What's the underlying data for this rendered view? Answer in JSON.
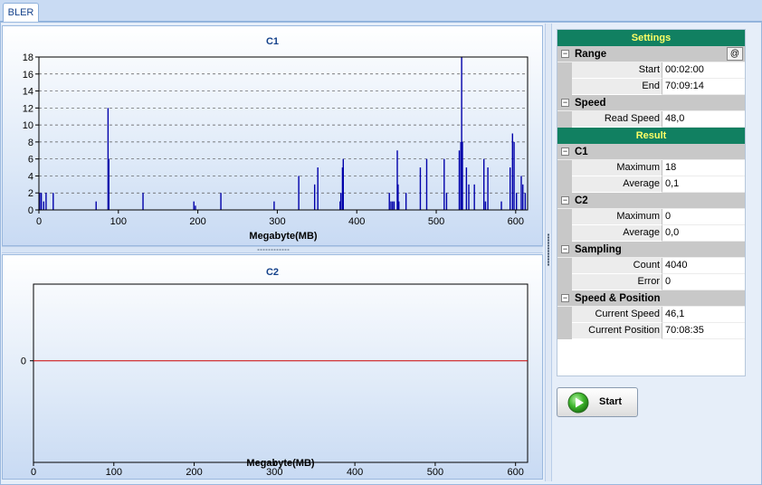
{
  "tabs": [
    {
      "label": "BLER"
    }
  ],
  "charts": {
    "c1": {
      "title": "C1",
      "xlabel": "Megabyte(MB)",
      "x_ticks": [
        "0",
        "100",
        "200",
        "300",
        "400",
        "500",
        "600"
      ],
      "y_ticks": [
        "0",
        "2",
        "4",
        "6",
        "8",
        "10",
        "12",
        "14",
        "16",
        "18"
      ]
    },
    "c2": {
      "title": "C2",
      "xlabel": "Megabyte(MB)",
      "x_ticks": [
        "0",
        "100",
        "200",
        "300",
        "400",
        "500",
        "600"
      ],
      "y_ticks": [
        "0"
      ]
    }
  },
  "chart_data": [
    {
      "type": "bar",
      "title": "C1",
      "xlabel": "Megabyte(MB)",
      "ylabel": "",
      "xlim": [
        0,
        615
      ],
      "ylim": [
        0,
        18
      ],
      "grid": true,
      "color": "#0000aa",
      "x": [
        1,
        3,
        6,
        9,
        18,
        72,
        87,
        88,
        131,
        195,
        197,
        229,
        296,
        327,
        347,
        351,
        379,
        380,
        382,
        383,
        441,
        443,
        445,
        447,
        451,
        452,
        453,
        462,
        480,
        488,
        510,
        513,
        529,
        531,
        532,
        533,
        538,
        541,
        548,
        560,
        562,
        565,
        582,
        593,
        596,
        598,
        601,
        607,
        609,
        612
      ],
      "values": [
        2,
        2,
        1,
        2,
        2,
        1,
        12,
        6,
        2,
        1,
        0.5,
        2,
        1,
        4,
        3,
        5,
        1,
        2,
        5,
        6,
        2,
        1,
        1,
        1,
        7,
        3,
        1,
        2,
        5,
        6,
        6,
        2,
        7,
        8,
        18,
        8,
        5,
        3,
        3,
        6,
        1,
        5,
        1,
        5,
        9,
        8,
        2,
        4,
        3,
        2
      ]
    },
    {
      "type": "line",
      "title": "C2",
      "xlabel": "Megabyte(MB)",
      "ylabel": "",
      "xlim": [
        0,
        615
      ],
      "color": "#cc0000",
      "x": [
        0,
        615
      ],
      "values": [
        0,
        0
      ]
    }
  ],
  "settings_header": "Settings",
  "result_header": "Result",
  "sections": {
    "range": {
      "label": "Range",
      "btn": "@",
      "toggle": "−",
      "start_label": "Start",
      "start_value": "00:02:00",
      "end_label": "End",
      "end_value": "70:09:14"
    },
    "speed": {
      "label": "Speed",
      "toggle": "−",
      "read_label": "Read Speed",
      "read_value": "48,0"
    },
    "c1": {
      "label": "C1",
      "toggle": "−",
      "max_label": "Maximum",
      "max_value": "18",
      "avg_label": "Average",
      "avg_value": "0,1"
    },
    "c2": {
      "label": "C2",
      "toggle": "−",
      "max_label": "Maximum",
      "max_value": "0",
      "avg_label": "Average",
      "avg_value": "0,0"
    },
    "sampling": {
      "label": "Sampling",
      "toggle": "−",
      "count_label": "Count",
      "count_value": "4040",
      "error_label": "Error",
      "error_value": "0"
    },
    "speed_position": {
      "label": "Speed & Position",
      "toggle": "−",
      "cur_speed_label": "Current Speed",
      "cur_speed_value": "46,1",
      "cur_pos_label": "Current Position",
      "cur_pos_value": "70:08:35"
    }
  },
  "start_button": {
    "label": "Start",
    "icon": "play-icon"
  }
}
